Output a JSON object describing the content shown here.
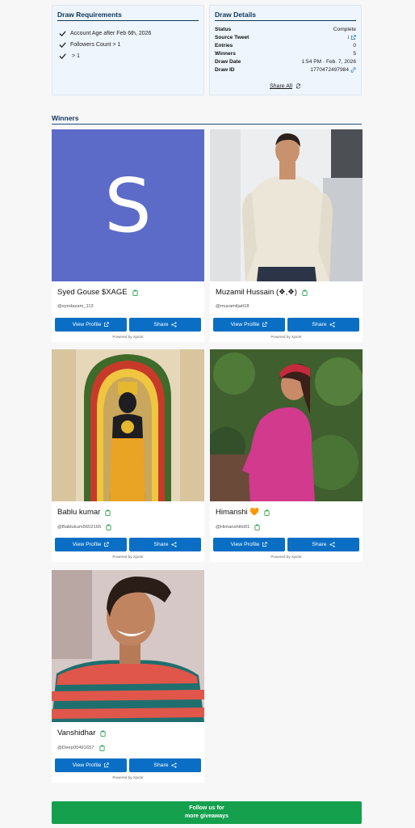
{
  "requirements": {
    "title": "Draw Requirements",
    "items": [
      "Account Age after Feb 6th, 2026",
      "Followers Count > 1",
      "> 1"
    ]
  },
  "details": {
    "title": "Draw Details",
    "rows": [
      {
        "label": "Status",
        "value": "Complete"
      },
      {
        "label": "Source Tweet",
        "value": "i"
      },
      {
        "label": "Entries",
        "value": "0"
      },
      {
        "label": "Winners",
        "value": "5"
      },
      {
        "label": "Draw Date",
        "value": "1:54 PM · Feb. 7, 2026"
      },
      {
        "label": "Draw ID",
        "value": "1770472497984"
      }
    ],
    "share_all": "Share All"
  },
  "winners_heading": "Winners",
  "winners": [
    {
      "name": "Syed Gouse $XAGE",
      "handle": "@syedazam_113",
      "avatar_letter": "S",
      "avatar_color": "#5c6bc8"
    },
    {
      "name": "Muzamil Hussain (❖,❖)",
      "handle": "@muzamiljatt18"
    },
    {
      "name": "Bablu kumar",
      "handle": "@Bablukum5652165"
    },
    {
      "name": "Himanshi 🧡",
      "handle": "@Himanshihii01"
    },
    {
      "name": "Vanshidhar",
      "handle": "@Deep00491657"
    }
  ],
  "buttons": {
    "view_profile": "View Profile",
    "share": "Share"
  },
  "powered_by": "Powered by Xpickr",
  "follow": {
    "line1": "Follow us for",
    "line2": "more giveaways"
  },
  "colors": {
    "accent": "#0a6fc4",
    "follow": "#14a04c",
    "heading": "#0f3557"
  }
}
